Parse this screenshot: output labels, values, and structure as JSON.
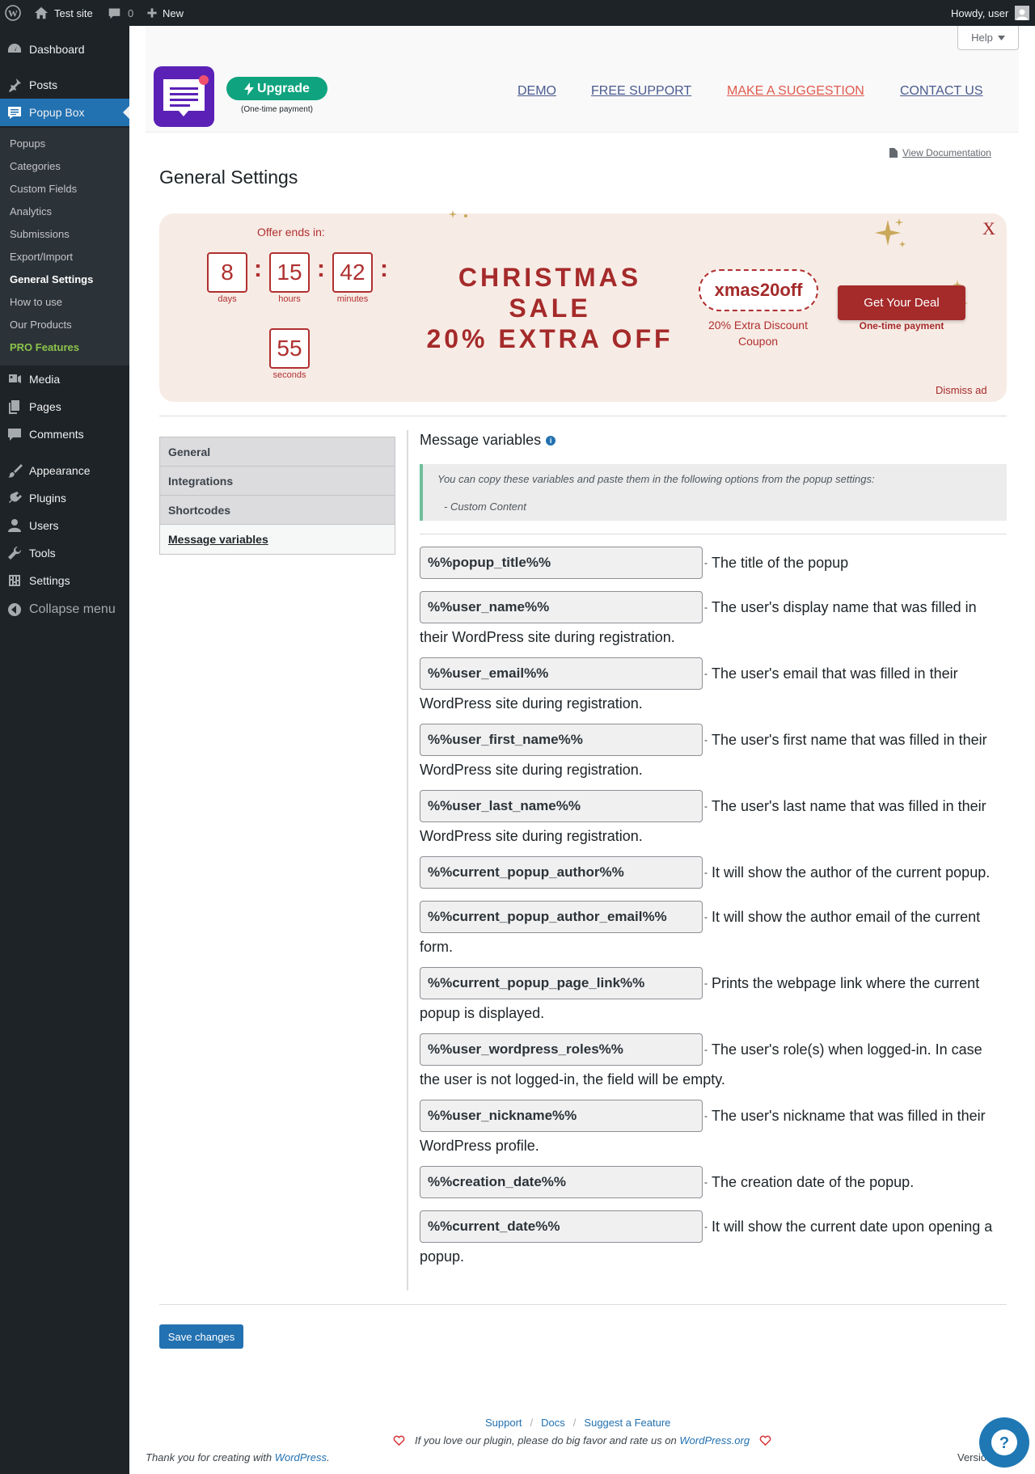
{
  "adminbar": {
    "site_name": "Test site",
    "comments_count": "0",
    "new_label": "New",
    "howdy": "Howdy, user"
  },
  "sidebar": {
    "dashboard": "Dashboard",
    "posts": "Posts",
    "popup_box": "Popup Box",
    "submenu": [
      "Popups",
      "Categories",
      "Custom Fields",
      "Analytics",
      "Submissions",
      "Export/Import",
      "General Settings",
      "How to use",
      "Our Products",
      "PRO Features"
    ],
    "media": "Media",
    "pages": "Pages",
    "comments": "Comments",
    "appearance": "Appearance",
    "plugins": "Plugins",
    "users": "Users",
    "tools": "Tools",
    "settings": "Settings",
    "collapse": "Collapse menu"
  },
  "header": {
    "help": "Help",
    "upgrade": "Upgrade",
    "one_time": "(One-time payment)",
    "links": {
      "demo": "DEMO",
      "support": "FREE SUPPORT",
      "suggestion": "MAKE A SUGGESTION",
      "contact": "CONTACT US"
    },
    "view_docs": "View Documentation"
  },
  "page_title": "General Settings",
  "xmas": {
    "offer_ends": "Offer ends in:",
    "days": "8",
    "days_label": "days",
    "hours": "15",
    "hours_label": "hours",
    "minutes": "42",
    "minutes_label": "minutes",
    "seconds": "55",
    "seconds_label": "seconds",
    "colon": ":",
    "title_line1": "CHRISTMAS",
    "title_line2": "SALE",
    "title_line3": "20% EXTRA OFF",
    "coupon": "xmas20off",
    "coupon_desc_1": "20% Extra Discount",
    "coupon_desc_2": "Coupon",
    "get_deal": "Get Your Deal",
    "deal_one_time": "One-time payment",
    "close": "X",
    "dismiss": "Dismiss ad"
  },
  "tabs": [
    "General",
    "Integrations",
    "Shortcodes",
    "Message variables"
  ],
  "content": {
    "section_title": "Message variables",
    "notice_line1": "You can copy these variables and paste them in the following options from the popup settings:",
    "notice_line2": "- Custom Content",
    "variables": [
      {
        "name": "%%popup_title%%",
        "desc": "The title of the popup",
        "cont": ""
      },
      {
        "name": "%%user_name%%",
        "desc": "The user's display name that was filled in",
        "cont": "their WordPress site during registration."
      },
      {
        "name": "%%user_email%%",
        "desc": "The user's email that was filled in their",
        "cont": "WordPress site during registration."
      },
      {
        "name": "%%user_first_name%%",
        "desc": "The user's first name that was filled in their",
        "cont": "WordPress site during registration."
      },
      {
        "name": "%%user_last_name%%",
        "desc": "The user's last name that was filled in their",
        "cont": "WordPress site during registration."
      },
      {
        "name": "%%current_popup_author%%",
        "desc": "It will show the author of the current popup.",
        "cont": ""
      },
      {
        "name": "%%current_popup_author_email%%",
        "desc": "It will show the author email of the current",
        "cont": "form."
      },
      {
        "name": "%%current_popup_page_link%%",
        "desc": "Prints the webpage link where the current",
        "cont": "popup is displayed."
      },
      {
        "name": "%%user_wordpress_roles%%",
        "desc": "The user's role(s) when logged-in. In case",
        "cont": "the user is not logged-in, the field will be empty."
      },
      {
        "name": "%%user_nickname%%",
        "desc": "The user's nickname that was filled in their",
        "cont": "WordPress profile."
      },
      {
        "name": "%%creation_date%%",
        "desc": "The creation date of the popup.",
        "cont": ""
      },
      {
        "name": "%%current_date%%",
        "desc": "It will show the current date upon opening a",
        "cont": "popup."
      }
    ],
    "dash": "-"
  },
  "save": "Save changes",
  "footer": {
    "support": "Support",
    "docs": "Docs",
    "suggest": "Suggest a Feature",
    "slash": "/",
    "love_text": "If you love our plugin, please do big favor and rate us on",
    "wp_org": "WordPress.org",
    "thanks_prefix": "Thank you for creating with",
    "thanks_wp": "WordPress",
    "thanks_suffix": ".",
    "version": "Versio"
  },
  "colors": {
    "admin_dark": "#1d2327",
    "accent_blue": "#2271b1",
    "xmas_red": "#a52a2a",
    "upgrade_green": "#10a37f",
    "logo_purple": "#5b21b6"
  }
}
